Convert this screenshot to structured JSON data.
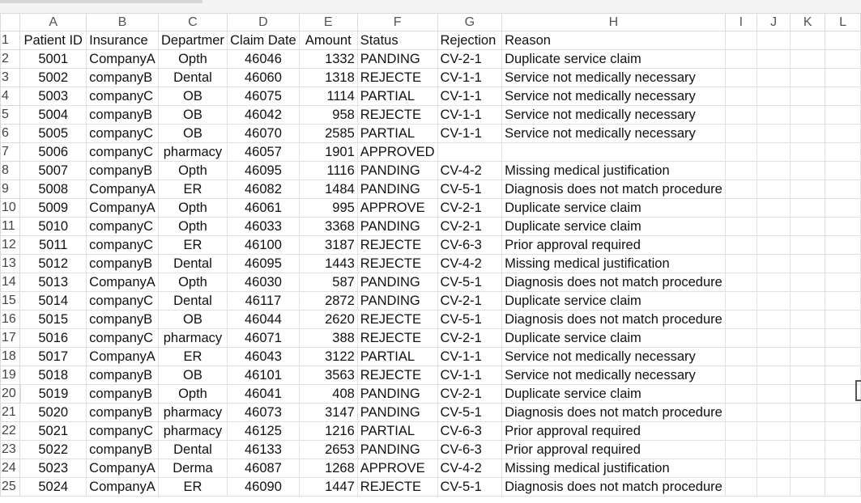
{
  "columns": [
    "A",
    "B",
    "C",
    "D",
    "E",
    "F",
    "G",
    "H",
    "I",
    "J",
    "K",
    "L"
  ],
  "header_row": {
    "row_number": "1",
    "cells": [
      "Patient ID",
      "Insurance",
      "Departmer",
      "Claim Date",
      "Amount",
      "Status",
      "Rejection",
      "Reason",
      "",
      "",
      "",
      ""
    ]
  },
  "rows": [
    {
      "n": "2",
      "id": "5001",
      "ins": "CompanyA",
      "dept": "Opth",
      "date": "46046",
      "amt": "1332",
      "status": "PANDING",
      "code": "CV-2-1",
      "reason": "Duplicate service claim"
    },
    {
      "n": "3",
      "id": "5002",
      "ins": "companyB",
      "dept": "Dental",
      "date": "46060",
      "amt": "1318",
      "status": "REJECTE",
      "code": "CV-1-1",
      "reason": "Service not medically necessary"
    },
    {
      "n": "4",
      "id": "5003",
      "ins": "companyC",
      "dept": "OB",
      "date": "46075",
      "amt": "1114",
      "status": "PARTIAL",
      "code": "CV-1-1",
      "reason": "Service not medically necessary"
    },
    {
      "n": "5",
      "id": "5004",
      "ins": "companyB",
      "dept": "OB",
      "date": "46042",
      "amt": "958",
      "status": "REJECTE",
      "code": "CV-1-1",
      "reason": "Service not medically necessary"
    },
    {
      "n": "6",
      "id": "5005",
      "ins": "companyC",
      "dept": "OB",
      "date": "46070",
      "amt": "2585",
      "status": "PARTIAL",
      "code": "CV-1-1",
      "reason": "Service not medically necessary"
    },
    {
      "n": "7",
      "id": "5006",
      "ins": "companyC",
      "dept": "pharmacy",
      "date": "46057",
      "amt": "1901",
      "status": "APPROVED",
      "code": "",
      "reason": ""
    },
    {
      "n": "8",
      "id": "5007",
      "ins": "companyB",
      "dept": "Opth",
      "date": "46095",
      "amt": "1116",
      "status": "PANDING",
      "code": "CV-4-2",
      "reason": "Missing medical justification"
    },
    {
      "n": "9",
      "id": "5008",
      "ins": "CompanyA",
      "dept": "ER",
      "date": "46082",
      "amt": "1484",
      "status": "PANDING",
      "code": "CV-5-1",
      "reason": "Diagnosis does not match procedure"
    },
    {
      "n": "10",
      "id": "5009",
      "ins": "CompanyA",
      "dept": "Opth",
      "date": "46061",
      "amt": "995",
      "status": "APPROVE",
      "code": "CV-2-1",
      "reason": "Duplicate service claim"
    },
    {
      "n": "11",
      "id": "5010",
      "ins": "companyC",
      "dept": "Opth",
      "date": "46033",
      "amt": "3368",
      "status": "PANDING",
      "code": "CV-2-1",
      "reason": "Duplicate service claim"
    },
    {
      "n": "12",
      "id": "5011",
      "ins": "companyC",
      "dept": "ER",
      "date": "46100",
      "amt": "3187",
      "status": "REJECTE",
      "code": "CV-6-3",
      "reason": "Prior approval required"
    },
    {
      "n": "13",
      "id": "5012",
      "ins": "companyB",
      "dept": "Dental",
      "date": "46095",
      "amt": "1443",
      "status": "REJECTE",
      "code": "CV-4-2",
      "reason": "Missing medical justification"
    },
    {
      "n": "14",
      "id": "5013",
      "ins": "CompanyA",
      "dept": "Opth",
      "date": "46030",
      "amt": "587",
      "status": "PANDING",
      "code": "CV-5-1",
      "reason": "Diagnosis does not match procedure"
    },
    {
      "n": "15",
      "id": "5014",
      "ins": "companyC",
      "dept": "Dental",
      "date": "46117",
      "amt": "2872",
      "status": "PANDING",
      "code": "CV-2-1",
      "reason": "Duplicate service claim"
    },
    {
      "n": "16",
      "id": "5015",
      "ins": "companyB",
      "dept": "OB",
      "date": "46044",
      "amt": "2620",
      "status": "REJECTE",
      "code": "CV-5-1",
      "reason": "Diagnosis does not match procedure"
    },
    {
      "n": "17",
      "id": "5016",
      "ins": "companyC",
      "dept": "pharmacy",
      "date": "46071",
      "amt": "388",
      "status": "REJECTE",
      "code": "CV-2-1",
      "reason": "Duplicate service claim"
    },
    {
      "n": "18",
      "id": "5017",
      "ins": "CompanyA",
      "dept": "ER",
      "date": "46043",
      "amt": "3122",
      "status": "PARTIAL",
      "code": "CV-1-1",
      "reason": "Service not medically necessary"
    },
    {
      "n": "19",
      "id": "5018",
      "ins": "companyB",
      "dept": "OB",
      "date": "46101",
      "amt": "3563",
      "status": "REJECTE",
      "code": "CV-1-1",
      "reason": "Service not medically necessary"
    },
    {
      "n": "20",
      "id": "5019",
      "ins": "companyB",
      "dept": "Opth",
      "date": "46041",
      "amt": "408",
      "status": "PANDING",
      "code": "CV-2-1",
      "reason": "Duplicate service claim"
    },
    {
      "n": "21",
      "id": "5020",
      "ins": "companyB",
      "dept": "pharmacy",
      "date": "46073",
      "amt": "3147",
      "status": "PANDING",
      "code": "CV-5-1",
      "reason": "Diagnosis does not match procedure"
    },
    {
      "n": "22",
      "id": "5021",
      "ins": "companyC",
      "dept": "pharmacy",
      "date": "46125",
      "amt": "1216",
      "status": "PARTIAL",
      "code": "CV-6-3",
      "reason": "Prior approval required"
    },
    {
      "n": "23",
      "id": "5022",
      "ins": "companyB",
      "dept": "Dental",
      "date": "46133",
      "amt": "2653",
      "status": "PANDING",
      "code": "CV-6-3",
      "reason": "Prior approval required"
    },
    {
      "n": "24",
      "id": "5023",
      "ins": "CompanyA",
      "dept": "Derma",
      "date": "46087",
      "amt": "1268",
      "status": "APPROVE",
      "code": "CV-4-2",
      "reason": "Missing medical justification"
    },
    {
      "n": "25",
      "id": "5024",
      "ins": "CompanyA",
      "dept": "ER",
      "date": "46090",
      "amt": "1447",
      "status": "REJECTE",
      "code": "CV-5-1",
      "reason": "Diagnosis does not match procedure"
    }
  ],
  "active_row": "20",
  "colors": {
    "active_accent": "#217346",
    "gridline": "#e1e1e1"
  }
}
